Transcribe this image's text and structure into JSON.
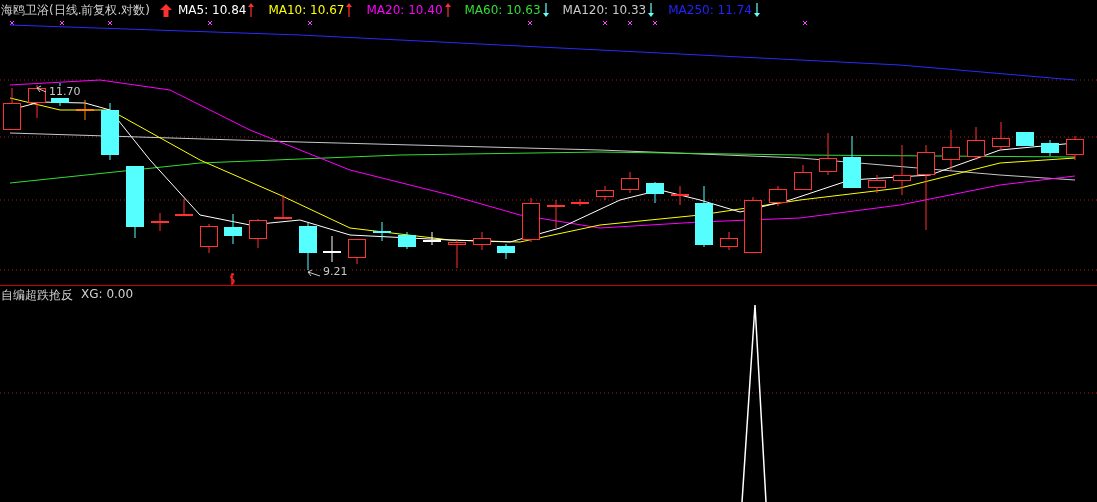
{
  "chart": {
    "title": "海鸥卫浴(日线.前复权.对数)",
    "rising": true,
    "moving_averages": [
      {
        "label": "MA5: 10.84",
        "color": "#ffffff",
        "rising": true
      },
      {
        "label": "MA10: 10.67",
        "color": "#ffff00",
        "rising": true
      },
      {
        "label": "MA20: 10.40",
        "color": "#ff00ff",
        "rising": true
      },
      {
        "label": "MA60: 10.63",
        "color": "#33dd33",
        "rising": false
      },
      {
        "label": "MA120: 10.33",
        "color": "#c8c8c8",
        "rising": false
      },
      {
        "label": "MA250: 11.74",
        "color": "#2222ff",
        "rising": false
      }
    ],
    "price_labels": [
      {
        "kind": "high",
        "text": "11.70"
      },
      {
        "kind": "low",
        "text": "9.21"
      }
    ]
  },
  "indicator": {
    "title": "自编超跌抢反",
    "reading": "XG: 0.00"
  }
}
